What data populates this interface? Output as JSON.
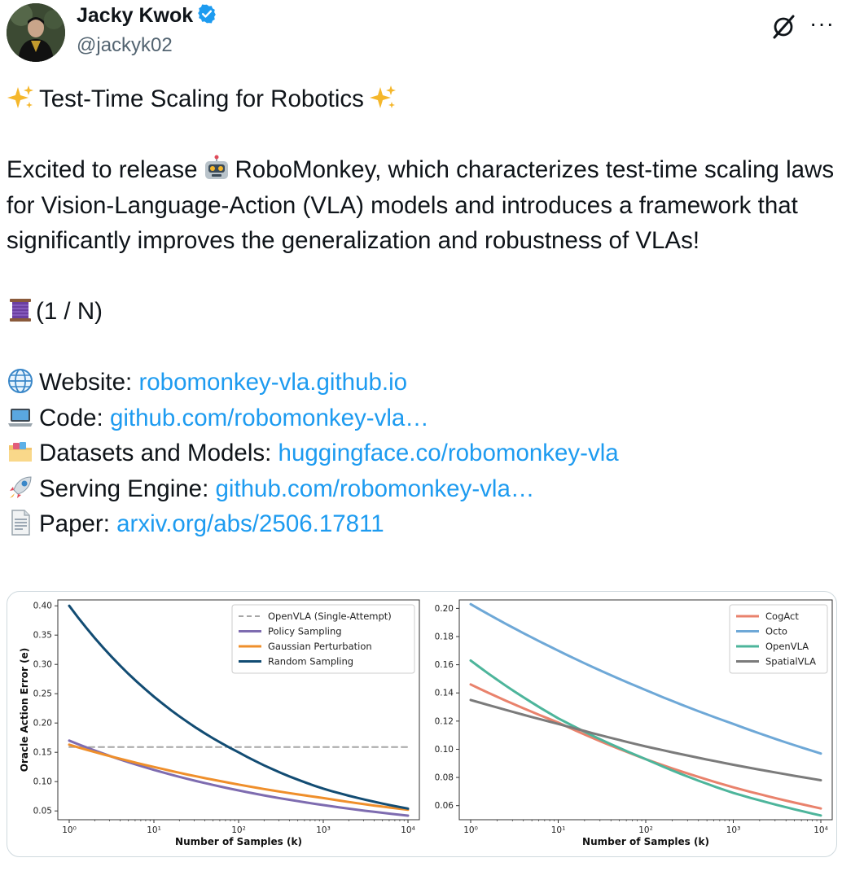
{
  "author": {
    "name": "Jacky Kwok",
    "handle": "@jackyk02",
    "verified": true,
    "avatar_icon": "avatar",
    "grok_icon": "grok-icon",
    "more_icon": "more-options-icon",
    "more_label": "···"
  },
  "post": {
    "headline": "Test-Time Scaling for Robotics",
    "intro_before": "Excited to release",
    "intro_after": "RoboMonkey, which characterizes test-time scaling laws for Vision-Language-Action (VLA) models and introduces a framework that significantly improves the generalization and robustness of VLAs!",
    "thread_marker": "(1 / N)",
    "links": [
      {
        "label": "Website:",
        "url": "robomonkey-vla.github.io",
        "icon": "globe-icon"
      },
      {
        "label": "Code:",
        "url": "github.com/robomonkey-vla…",
        "icon": "laptop-icon"
      },
      {
        "label": "Datasets and Models:",
        "url": "huggingface.co/robomonkey-vla",
        "icon": "folder-icon"
      },
      {
        "label": "Serving Engine:",
        "url": "github.com/robomonkey-vla…",
        "icon": "rocket-icon"
      },
      {
        "label": "Paper:",
        "url": "arxiv.org/abs/2506.17811",
        "icon": "document-icon"
      }
    ]
  },
  "colors": {
    "link": "#1d9bf0",
    "text": "#0f1419",
    "muted": "#536471",
    "verified": "#1d9bf0"
  },
  "chart_data": [
    {
      "type": "line",
      "xscale": "log",
      "x": [
        1,
        10,
        100,
        1000,
        10000
      ],
      "xticks": [
        "10⁰",
        "10¹",
        "10²",
        "10³",
        "10⁴"
      ],
      "xlabel": "Number of Samples (k)",
      "ylabel": "Oracle Action Error (e)",
      "ylim": [
        0.035,
        0.41
      ],
      "yticks": [
        "0.05",
        "0.10",
        "0.15",
        "0.20",
        "0.25",
        "0.30",
        "0.35",
        "0.40"
      ],
      "ytick_values": [
        0.05,
        0.1,
        0.15,
        0.2,
        0.25,
        0.3,
        0.35,
        0.4
      ],
      "legend_position": "top-right",
      "series": [
        {
          "name": "OpenVLA (Single-Attempt)",
          "values": [
            0.159,
            0.159,
            0.159,
            0.159,
            0.159
          ],
          "color": "#a6a6a6",
          "dashed": true
        },
        {
          "name": "Policy Sampling",
          "values": [
            0.17,
            0.12,
            0.085,
            0.06,
            0.042
          ],
          "color": "#7e6cb0"
        },
        {
          "name": "Gaussian Perturbation",
          "values": [
            0.163,
            0.125,
            0.095,
            0.072,
            0.052
          ],
          "color": "#ef8f2b"
        },
        {
          "name": "Random Sampling",
          "values": [
            0.4,
            0.245,
            0.15,
            0.088,
            0.054
          ],
          "color": "#124c73"
        }
      ]
    },
    {
      "type": "line",
      "xscale": "log",
      "x": [
        1,
        10,
        100,
        1000,
        10000
      ],
      "xticks": [
        "10⁰",
        "10¹",
        "10²",
        "10³",
        "10⁴"
      ],
      "xlabel": "Number of Samples (k)",
      "ylabel": "",
      "ylim": [
        0.05,
        0.206
      ],
      "yticks": [
        "0.06",
        "0.08",
        "0.10",
        "0.12",
        "0.14",
        "0.16",
        "0.18",
        "0.20"
      ],
      "ytick_values": [
        0.06,
        0.08,
        0.1,
        0.12,
        0.14,
        0.16,
        0.18,
        0.2
      ],
      "legend_position": "top-right",
      "series": [
        {
          "name": "CogAct",
          "values": [
            0.146,
            0.119,
            0.093,
            0.073,
            0.058
          ],
          "color": "#e9826c"
        },
        {
          "name": "Octo",
          "values": [
            0.203,
            0.17,
            0.142,
            0.118,
            0.097
          ],
          "color": "#6ea8d7"
        },
        {
          "name": "OpenVLA",
          "values": [
            0.163,
            0.122,
            0.093,
            0.069,
            0.053
          ],
          "color": "#4db59b"
        },
        {
          "name": "SpatialVLA",
          "values": [
            0.135,
            0.118,
            0.102,
            0.089,
            0.078
          ],
          "color": "#7b7b7b"
        }
      ]
    }
  ]
}
